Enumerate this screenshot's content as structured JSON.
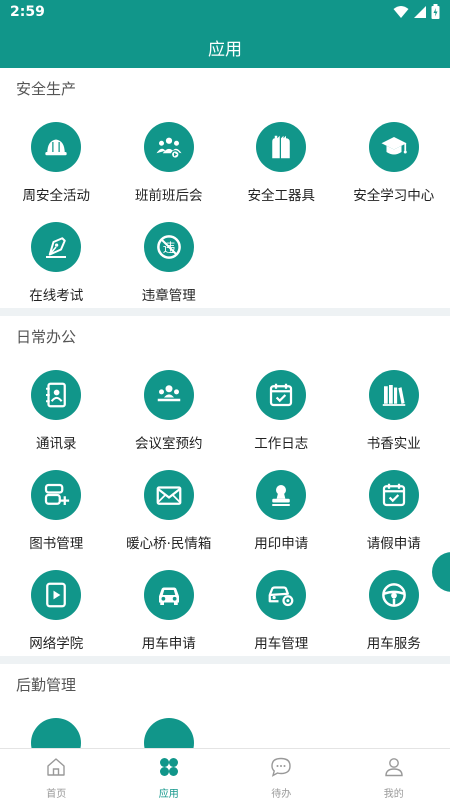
{
  "status_bar": {
    "time": "2:59"
  },
  "header": {
    "title": "应用"
  },
  "sections": [
    {
      "title": "安全生产",
      "items": [
        {
          "label": "周安全活动",
          "icon": "hard-hat-icon"
        },
        {
          "label": "班前班后会",
          "icon": "group-meeting-icon"
        },
        {
          "label": "安全工器具",
          "icon": "gloves-icon"
        },
        {
          "label": "安全学习中心",
          "icon": "graduation-cap-icon"
        },
        {
          "label": "在线考试",
          "icon": "pen-nib-icon"
        },
        {
          "label": "违章管理",
          "icon": "prohibited-icon"
        }
      ]
    },
    {
      "title": "日常办公",
      "items": [
        {
          "label": "通讯录",
          "icon": "contacts-icon"
        },
        {
          "label": "会议室预约",
          "icon": "meeting-room-icon"
        },
        {
          "label": "工作日志",
          "icon": "calendar-check-icon"
        },
        {
          "label": "书香实业",
          "icon": "books-icon"
        },
        {
          "label": "图书管理",
          "icon": "book-add-icon"
        },
        {
          "label": "暖心桥·民情箱",
          "icon": "mail-icon"
        },
        {
          "label": "用印申请",
          "icon": "stamp-icon"
        },
        {
          "label": "请假申请",
          "icon": "calendar-check-icon"
        },
        {
          "label": "网络学院",
          "icon": "video-play-icon"
        },
        {
          "label": "用车申请",
          "icon": "car-icon"
        },
        {
          "label": "用车管理",
          "icon": "car-gear-icon"
        },
        {
          "label": "用车服务",
          "icon": "steering-wheel-icon"
        }
      ]
    },
    {
      "title": "后勤管理",
      "items": [
        {
          "label": "",
          "icon": "partial-icon"
        },
        {
          "label": "",
          "icon": "partial-icon"
        }
      ]
    }
  ],
  "tabs": [
    {
      "label": "首页",
      "icon": "home-icon",
      "active": false
    },
    {
      "label": "应用",
      "icon": "apps-icon",
      "active": true
    },
    {
      "label": "待办",
      "icon": "chat-icon",
      "active": false
    },
    {
      "label": "我的",
      "icon": "user-icon",
      "active": false
    }
  ],
  "colors": {
    "primary": "#11968a",
    "inactive": "#999999"
  }
}
